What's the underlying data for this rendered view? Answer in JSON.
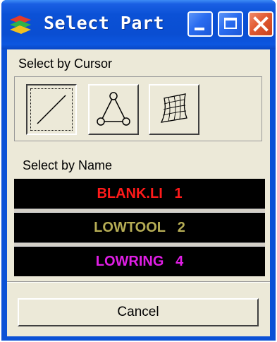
{
  "window": {
    "title": "Select Part"
  },
  "sections": {
    "cursor_label": "Select by Cursor",
    "name_label": "Select by Name"
  },
  "tools": [
    {
      "icon": "line-icon",
      "active": true
    },
    {
      "icon": "triangle-nodes-icon",
      "active": false
    },
    {
      "icon": "surface-mesh-icon",
      "active": false
    }
  ],
  "parts": [
    {
      "name": "BLANK.LI",
      "id": "1",
      "color": "#ff1a1a"
    },
    {
      "name": "LOWTOOL",
      "id": "2",
      "color": "#b6ad55"
    },
    {
      "name": "LOWRING",
      "id": "4",
      "color": "#e11ee6"
    }
  ],
  "buttons": {
    "cancel_label": "Cancel"
  }
}
